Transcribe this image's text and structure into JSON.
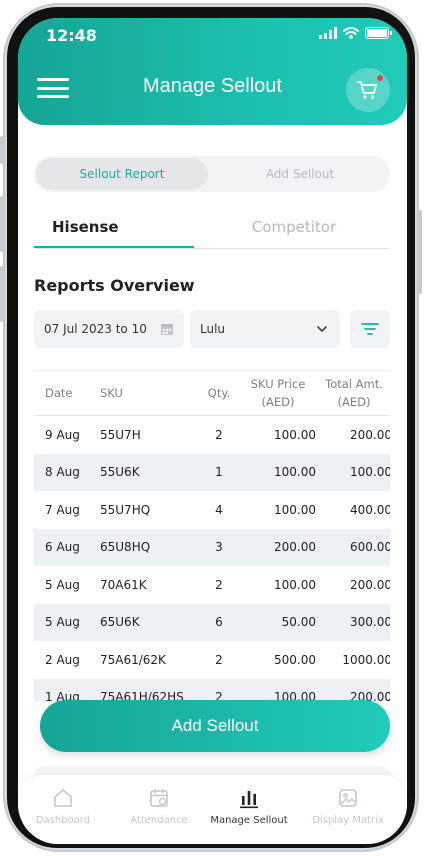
{
  "status_bar": {
    "time": "12:48"
  },
  "header": {
    "title": "Manage Sellout"
  },
  "segment": {
    "active": "Sellout Report",
    "inactive": "Add Sellout"
  },
  "tabs": {
    "active": "Hisense",
    "inactive": "Competitor"
  },
  "section_title": "Reports Overview",
  "filters": {
    "date_range": "07 Jul 2023 to 10",
    "store": "Lulu"
  },
  "table": {
    "headers": {
      "date": "Date",
      "sku": "SKU",
      "qty": "Qty.",
      "price_line1": "SKU Price",
      "price_line2": "(AED)",
      "total_line1": "Total Amt.",
      "total_line2": "(AED)"
    },
    "rows": [
      {
        "date": "9 Aug",
        "sku": "55U7H",
        "qty": "2",
        "price": "100.00",
        "total": "200.00"
      },
      {
        "date": "8 Aug",
        "sku": "55U6K",
        "qty": "1",
        "price": "100.00",
        "total": "100.00"
      },
      {
        "date": "7 Aug",
        "sku": "55U7HQ",
        "qty": "4",
        "price": "100.00",
        "total": "400.00"
      },
      {
        "date": "6 Aug",
        "sku": "65U8HQ",
        "qty": "3",
        "price": "200.00",
        "total": "600.00"
      },
      {
        "date": "5 Aug",
        "sku": "70A61K",
        "qty": "2",
        "price": "100.00",
        "total": "200.00"
      },
      {
        "date": "5 Aug",
        "sku": "65U6K",
        "qty": "6",
        "price": "50.00",
        "total": "300.00"
      },
      {
        "date": "2 Aug",
        "sku": "75A61/62K",
        "qty": "2",
        "price": "500.00",
        "total": "1000.00"
      },
      {
        "date": "1 Aug",
        "sku": "75A61H/62HS",
        "qty": "2",
        "price": "100.00",
        "total": "200.00"
      }
    ]
  },
  "add_button": "Add Sellout",
  "nav": {
    "dashboard": "Dashboard",
    "attendance": "Attendance",
    "manage_sellout": "Manage Sellout",
    "display_matrix": "Display Matrix"
  },
  "colors": {
    "accent": "#17b0a0",
    "row_alt": "#edf1f3",
    "notification": "#e8413b"
  },
  "icons": {
    "menu": "hamburger-icon",
    "cart": "cart-icon",
    "calendar": "calendar-icon",
    "dropdown": "chevron-down-icon",
    "filter": "filter-icon",
    "nav_dashboard": "home-icon",
    "nav_attendance": "calendar-icon",
    "nav_manage_sellout": "bar-chart-icon",
    "nav_display_matrix": "image-icon"
  }
}
